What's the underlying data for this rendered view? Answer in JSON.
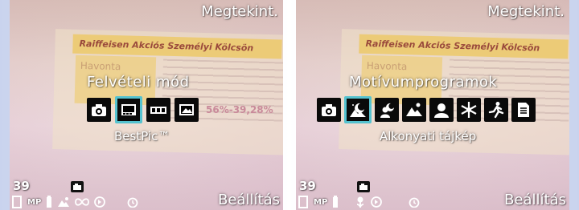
{
  "left": {
    "top_label": "Megtekint.",
    "mode_title": "Felvételi mód",
    "selected_label": "BestPic™",
    "bottom_right": "Beállítás",
    "shot_count": "39",
    "background_doc": {
      "title": "Raiffeisen Akciós Személyi Kölcsön",
      "subtitle": "Havonta",
      "percent": "56%-39,28%"
    },
    "icons": [
      {
        "name": "camera-icon",
        "selected": false
      },
      {
        "name": "bestpic-icon",
        "selected": true
      },
      {
        "name": "panorama-icon",
        "selected": false
      },
      {
        "name": "landscape-photo-icon",
        "selected": false
      }
    ],
    "status_icons": [
      "storage-icon",
      "mp-label",
      "battery-icon",
      "landscape-mode-icon",
      "infinity-icon",
      "stabilizer-icon",
      "self-timer-icon"
    ],
    "mp_text": "MP"
  },
  "right": {
    "top_label": "Megtekint.",
    "mode_title": "Motívumprogramok",
    "selected_label": "Alkonyati tájkép",
    "bottom_right": "Beállítás",
    "shot_count": "39",
    "icons": [
      {
        "name": "auto-camera-icon",
        "selected": false
      },
      {
        "name": "twilight-landscape-icon",
        "selected": true
      },
      {
        "name": "night-portrait-icon",
        "selected": false
      },
      {
        "name": "landscape-icon",
        "selected": false
      },
      {
        "name": "portrait-icon",
        "selected": false
      },
      {
        "name": "snow-icon",
        "selected": false
      },
      {
        "name": "sports-icon",
        "selected": false
      },
      {
        "name": "document-icon",
        "selected": false
      }
    ],
    "status_icons": [
      "storage-icon",
      "mp-label",
      "battery-icon",
      "macro-icon",
      "stabilizer-icon",
      "self-timer-icon"
    ],
    "mp_text": "MP"
  }
}
